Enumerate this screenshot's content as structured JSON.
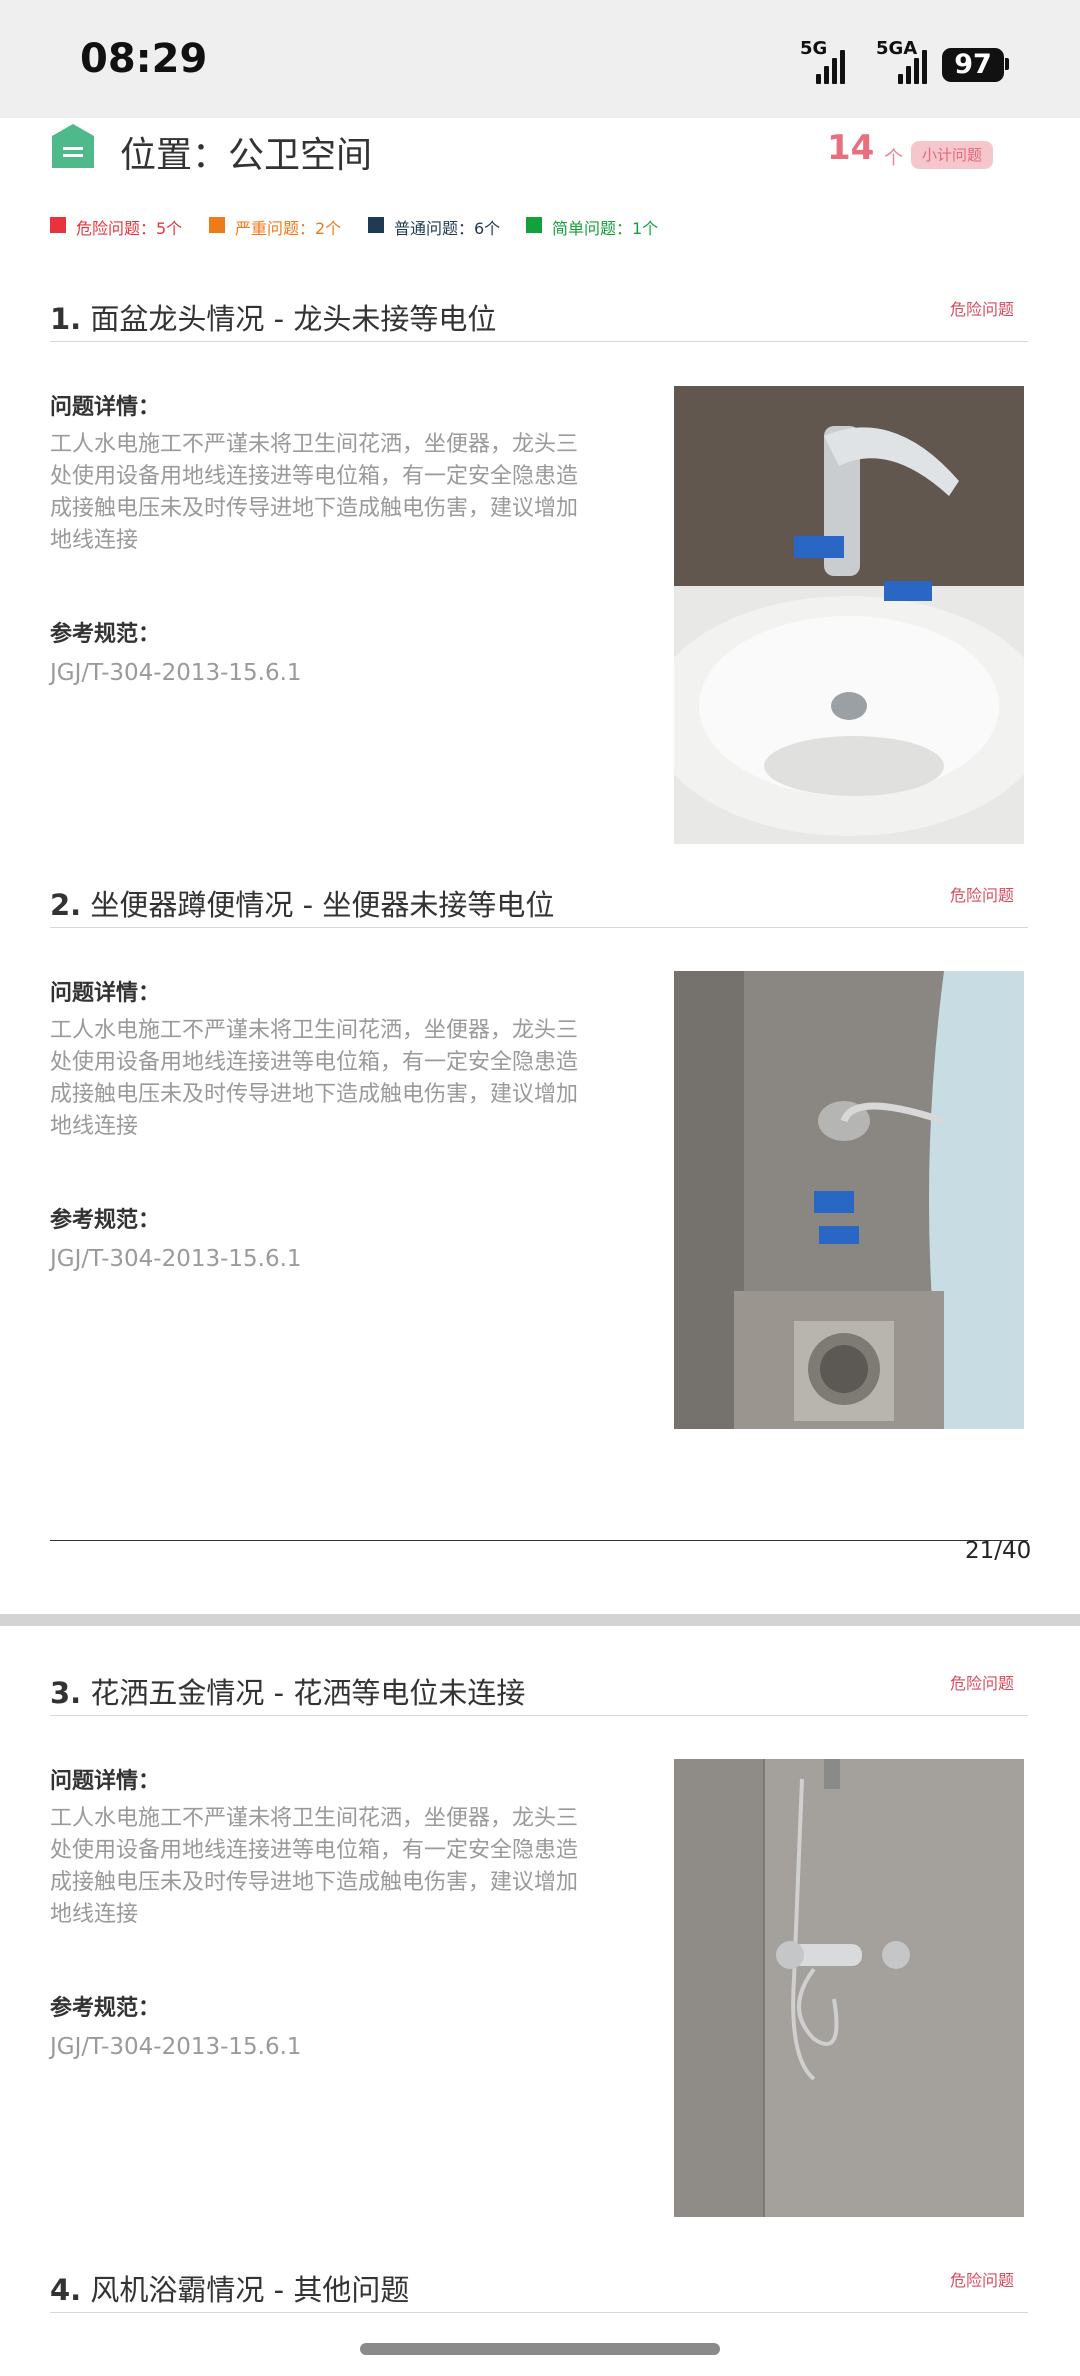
{
  "status_bar": {
    "time": "08:29",
    "signal1": "5G",
    "signal2": "5GA",
    "battery": "97"
  },
  "header": {
    "title": "位置：公卫空间",
    "count": "14",
    "count_unit": "个",
    "count_badge": "小计问题"
  },
  "colors": {
    "danger": "#e8333c",
    "serious": "#f07a18",
    "normal": "#1f3a55",
    "simple": "#14a03c",
    "header_icon": "#4fb98c"
  },
  "legend": [
    {
      "label": "危险问题：5个"
    },
    {
      "label": "严重问题：2个"
    },
    {
      "label": "普通问题：6个"
    },
    {
      "label": "简单问题：1个"
    }
  ],
  "items": [
    {
      "number": "1.",
      "title": "面盆龙头情况 - 龙头未接等电位",
      "tag": "危险问题",
      "detail_label": "问题详情：",
      "detail": "工人水电施工不严谨未将卫生间花洒，坐便器，龙头三处使用设备用地线连接进等电位箱，有一定安全隐患造成接触电压未及时传导进地下造成触电伤害，建议增加地线连接",
      "ref_label": "参考规范：",
      "ref": "JGJ/T-304-2013-15.6.1"
    },
    {
      "number": "2.",
      "title": "坐便器蹲便情况 - 坐便器未接等电位",
      "tag": "危险问题",
      "detail_label": "问题详情：",
      "detail": "工人水电施工不严谨未将卫生间花洒，坐便器，龙头三处使用设备用地线连接进等电位箱，有一定安全隐患造成接触电压未及时传导进地下造成触电伤害，建议增加地线连接",
      "ref_label": "参考规范：",
      "ref": "JGJ/T-304-2013-15.6.1"
    },
    {
      "number": "3.",
      "title": "花洒五金情况 - 花洒等电位未连接",
      "tag": "危险问题",
      "detail_label": "问题详情：",
      "detail": "工人水电施工不严谨未将卫生间花洒，坐便器，龙头三处使用设备用地线连接进等电位箱，有一定安全隐患造成接触电压未及时传导进地下造成触电伤害，建议增加地线连接",
      "ref_label": "参考规范：",
      "ref": "JGJ/T-304-2013-15.6.1"
    },
    {
      "number": "4.",
      "title": "风机浴霸情况 - 其他问题",
      "tag": "危险问题"
    }
  ],
  "page": {
    "number": "21/40"
  }
}
